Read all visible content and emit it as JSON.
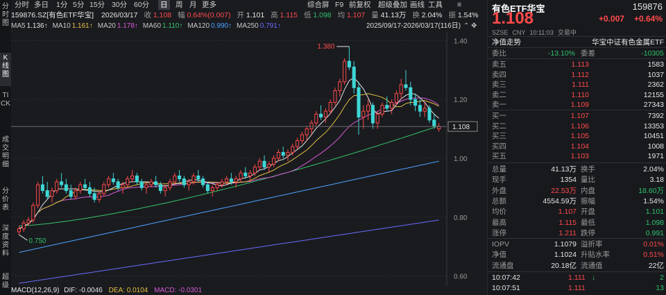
{
  "left_tabs": [
    "分时图",
    "K线图",
    "TICK",
    "成交明细",
    "分价表",
    "深度资料",
    "超级"
  ],
  "toolbar": {
    "periods": [
      "分时",
      "多日",
      "1分",
      "5分",
      "15分",
      "30分",
      "60分",
      "日",
      "周",
      "月",
      "更多"
    ],
    "active_period": "日",
    "right_tools": [
      "综合屏",
      "F9",
      "前复权",
      "超级叠加",
      "画线",
      "工具"
    ]
  },
  "info": {
    "code_name": "159876.SZ[有色ETF华宝]",
    "date": "2026/03/17",
    "close_label": "收",
    "close": "1.108",
    "change_label": "幅",
    "change": "0.64%(0.007)",
    "open_label": "开",
    "open": "1.101",
    "high_label": "高",
    "high": "1.115",
    "low_label": "低",
    "low": "1.098",
    "prev_label": "均",
    "prev": "1.107",
    "vol_label": "量",
    "vol": "41.13万",
    "turnover_label": "换",
    "turnover": "2.04%",
    "amp_label": "振",
    "amp": "1.54%"
  },
  "ma": [
    {
      "name": "MA5",
      "value": "1.136",
      "color": "#e6e6e6"
    },
    {
      "name": "MA10",
      "value": "1.161",
      "color": "#e3c042"
    },
    {
      "name": "MA20",
      "value": "1.178",
      "color": "#d65ad6"
    },
    {
      "name": "MA60",
      "value": "1.110",
      "color": "#35c36b"
    },
    {
      "name": "MA120",
      "value": "0.990",
      "color": "#4aa3ff"
    },
    {
      "name": "MA250",
      "value": "0.791",
      "color": "#6b6bff"
    }
  ],
  "range_text": "2025/09/17-2026/03/17(116日)",
  "chart_data": {
    "type": "candlestick",
    "y_ticks": [
      "1.40",
      "1.20",
      "1.00",
      "0.80",
      "0.60"
    ],
    "ylim": [
      0.58,
      1.42
    ],
    "current_price_tag": "1.108",
    "max_label": "1.380",
    "min_label": "0.750",
    "candles": [
      [
        0.75,
        0.77,
        0.74,
        0.76
      ],
      [
        0.76,
        0.79,
        0.75,
        0.78
      ],
      [
        0.78,
        0.8,
        0.77,
        0.79
      ],
      [
        0.79,
        0.85,
        0.78,
        0.84
      ],
      [
        0.84,
        0.92,
        0.83,
        0.91
      ],
      [
        0.91,
        0.94,
        0.88,
        0.89
      ],
      [
        0.89,
        0.92,
        0.86,
        0.87
      ],
      [
        0.87,
        0.9,
        0.85,
        0.89
      ],
      [
        0.89,
        0.93,
        0.88,
        0.92
      ],
      [
        0.92,
        0.95,
        0.9,
        0.91
      ],
      [
        0.91,
        0.93,
        0.88,
        0.89
      ],
      [
        0.89,
        0.91,
        0.86,
        0.87
      ],
      [
        0.87,
        0.9,
        0.86,
        0.89
      ],
      [
        0.89,
        0.92,
        0.88,
        0.91
      ],
      [
        0.91,
        0.93,
        0.89,
        0.9
      ],
      [
        0.9,
        0.92,
        0.87,
        0.88
      ],
      [
        0.88,
        0.9,
        0.85,
        0.86
      ],
      [
        0.86,
        0.89,
        0.85,
        0.88
      ],
      [
        0.88,
        0.92,
        0.87,
        0.91
      ],
      [
        0.91,
        0.94,
        0.9,
        0.93
      ],
      [
        0.93,
        0.95,
        0.91,
        0.92
      ],
      [
        0.92,
        0.93,
        0.89,
        0.9
      ],
      [
        0.9,
        0.92,
        0.88,
        0.91
      ],
      [
        0.91,
        0.94,
        0.9,
        0.93
      ],
      [
        0.93,
        0.96,
        0.92,
        0.94
      ],
      [
        0.94,
        0.95,
        0.91,
        0.92
      ],
      [
        0.92,
        0.93,
        0.89,
        0.9
      ],
      [
        0.9,
        0.92,
        0.88,
        0.91
      ],
      [
        0.91,
        0.93,
        0.9,
        0.92
      ],
      [
        0.92,
        0.94,
        0.9,
        0.91
      ],
      [
        0.91,
        0.92,
        0.88,
        0.89
      ],
      [
        0.89,
        0.91,
        0.87,
        0.9
      ],
      [
        0.9,
        0.93,
        0.89,
        0.92
      ],
      [
        0.92,
        0.95,
        0.91,
        0.94
      ],
      [
        0.94,
        0.96,
        0.92,
        0.93
      ],
      [
        0.93,
        0.94,
        0.9,
        0.91
      ],
      [
        0.91,
        0.93,
        0.89,
        0.92
      ],
      [
        0.92,
        0.95,
        0.91,
        0.94
      ],
      [
        0.94,
        0.96,
        0.92,
        0.93
      ],
      [
        0.93,
        0.94,
        0.9,
        0.91
      ],
      [
        0.91,
        0.92,
        0.88,
        0.89
      ],
      [
        0.89,
        0.91,
        0.87,
        0.9
      ],
      [
        0.9,
        0.92,
        0.89,
        0.91
      ],
      [
        0.91,
        0.93,
        0.9,
        0.92
      ],
      [
        0.92,
        0.94,
        0.91,
        0.93
      ],
      [
        0.93,
        0.95,
        0.91,
        0.92
      ],
      [
        0.92,
        0.94,
        0.9,
        0.93
      ],
      [
        0.93,
        0.96,
        0.92,
        0.95
      ],
      [
        0.95,
        0.97,
        0.93,
        0.94
      ],
      [
        0.94,
        0.96,
        0.92,
        0.95
      ],
      [
        0.95,
        0.98,
        0.94,
        0.97
      ],
      [
        0.97,
        1.0,
        0.96,
        0.99
      ],
      [
        0.99,
        1.01,
        0.96,
        0.97
      ],
      [
        0.97,
        0.99,
        0.95,
        0.98
      ],
      [
        0.98,
        1.01,
        0.97,
        1.0
      ],
      [
        1.0,
        1.03,
        0.99,
        1.02
      ],
      [
        1.02,
        1.04,
        1.0,
        1.01
      ],
      [
        1.01,
        1.03,
        0.99,
        1.02
      ],
      [
        1.02,
        1.05,
        1.01,
        1.04
      ],
      [
        1.04,
        1.07,
        1.03,
        1.06
      ],
      [
        1.06,
        1.09,
        1.05,
        1.08
      ],
      [
        1.08,
        1.11,
        1.06,
        1.1
      ],
      [
        1.1,
        1.13,
        1.08,
        1.12
      ],
      [
        1.12,
        1.16,
        1.11,
        1.15
      ],
      [
        1.15,
        1.18,
        1.13,
        1.14
      ],
      [
        1.14,
        1.17,
        1.12,
        1.16
      ],
      [
        1.16,
        1.2,
        1.15,
        1.19
      ],
      [
        1.19,
        1.24,
        1.18,
        1.23
      ],
      [
        1.23,
        1.27,
        1.21,
        1.26
      ],
      [
        1.26,
        1.34,
        1.25,
        1.33
      ],
      [
        1.33,
        1.38,
        1.3,
        1.31
      ],
      [
        1.31,
        1.33,
        1.22,
        1.24
      ],
      [
        1.24,
        1.26,
        1.08,
        1.14
      ],
      [
        1.14,
        1.18,
        1.1,
        1.16
      ],
      [
        1.16,
        1.2,
        1.13,
        1.18
      ],
      [
        1.18,
        1.19,
        1.1,
        1.12
      ],
      [
        1.12,
        1.16,
        1.1,
        1.15
      ],
      [
        1.15,
        1.19,
        1.14,
        1.18
      ],
      [
        1.18,
        1.21,
        1.16,
        1.17
      ],
      [
        1.17,
        1.2,
        1.15,
        1.19
      ],
      [
        1.19,
        1.23,
        1.18,
        1.22
      ],
      [
        1.22,
        1.27,
        1.2,
        1.25
      ],
      [
        1.25,
        1.3,
        1.23,
        1.24
      ],
      [
        1.24,
        1.26,
        1.18,
        1.2
      ],
      [
        1.2,
        1.22,
        1.16,
        1.18
      ],
      [
        1.18,
        1.2,
        1.14,
        1.16
      ],
      [
        1.16,
        1.19,
        1.14,
        1.17
      ],
      [
        1.17,
        1.18,
        1.12,
        1.13
      ],
      [
        1.13,
        1.15,
        1.1,
        1.11
      ],
      [
        1.1,
        1.12,
        1.09,
        1.108
      ]
    ]
  },
  "macd": {
    "title": "MACD(12,26,9)",
    "dif_label": "DIF:",
    "dif": "-0.0046",
    "dea_label": "DEA:",
    "dea": "0.0104",
    "macd_label": "MACD:",
    "macd": "-0.0301"
  },
  "quote": {
    "name": "有色ETF华宝",
    "code": "159876",
    "price": "1.108",
    "change": "+0.007",
    "change_pct": "+0.64%",
    "meta": [
      "SZSE",
      "CNY",
      "10:11:03",
      "交易中"
    ],
    "nav_label": "净值走势",
    "fund_name": "华宝中证有色金属ETF",
    "weibi_label": "委比",
    "weibi": "-13.10%",
    "weicha_label": "委差",
    "weicha": "-10305",
    "asks": [
      {
        "label": "卖五",
        "price": "1.113",
        "vol": "1583"
      },
      {
        "label": "卖四",
        "price": "1.112",
        "vol": "1037"
      },
      {
        "label": "卖三",
        "price": "1.111",
        "vol": "2362"
      },
      {
        "label": "卖二",
        "price": "1.110",
        "vol": "12155"
      },
      {
        "label": "卖一",
        "price": "1.109",
        "vol": "27343"
      }
    ],
    "bids": [
      {
        "label": "买一",
        "price": "1.107",
        "vol": "7392"
      },
      {
        "label": "买二",
        "price": "1.106",
        "vol": "13353"
      },
      {
        "label": "买三",
        "price": "1.105",
        "vol": "10451"
      },
      {
        "label": "买四",
        "price": "1.104",
        "vol": "1008"
      },
      {
        "label": "买五",
        "price": "1.103",
        "vol": "1971"
      }
    ],
    "stats": [
      [
        {
          "l": "总量",
          "v": "41.13万",
          "c": "white"
        },
        {
          "l": "换手",
          "v": "2.04%",
          "c": "white"
        }
      ],
      [
        {
          "l": "现手",
          "v": "1354",
          "c": "white"
        },
        {
          "l": "量比",
          "v": "3.18",
          "c": "white"
        }
      ],
      [
        {
          "l": "外盘",
          "v": "22.53万",
          "c": "red"
        },
        {
          "l": "内盘",
          "v": "18.60万",
          "c": "green"
        }
      ],
      [
        {
          "l": "总额",
          "v": "4554.59万",
          "c": "white"
        },
        {
          "l": "振幅",
          "v": "1.54%",
          "c": "white"
        }
      ],
      [
        {
          "l": "均价",
          "v": "1.107",
          "c": "red"
        },
        {
          "l": "开盘",
          "v": "1.101",
          "c": "green"
        }
      ],
      [
        {
          "l": "最高",
          "v": "1.115",
          "c": "red"
        },
        {
          "l": "最低",
          "v": "1.098",
          "c": "green"
        }
      ],
      [
        {
          "l": "涨停",
          "v": "1.211",
          "c": "red"
        },
        {
          "l": "跌停",
          "v": "0.991",
          "c": "green"
        }
      ]
    ],
    "iopv": [
      [
        {
          "l": "IOPV",
          "v": "1.1079",
          "c": "white"
        },
        {
          "l": "溢折率",
          "v": "0.01%",
          "c": "red"
        }
      ],
      [
        {
          "l": "净值",
          "v": "1.1024",
          "c": "white"
        },
        {
          "l": "升贴水率",
          "v": "0.51%",
          "c": "red"
        }
      ],
      [
        {
          "l": "流通盘",
          "v": "20.18亿",
          "c": "white"
        },
        {
          "l": "流通值",
          "v": "22亿",
          "c": "white"
        }
      ]
    ],
    "ticks": [
      {
        "time": "10:07:42",
        "price": "1.111",
        "arrow": "↓",
        "vol": "2"
      },
      {
        "time": "10:07:51",
        "price": "1.111",
        "arrow": "",
        "vol": "13"
      }
    ]
  }
}
